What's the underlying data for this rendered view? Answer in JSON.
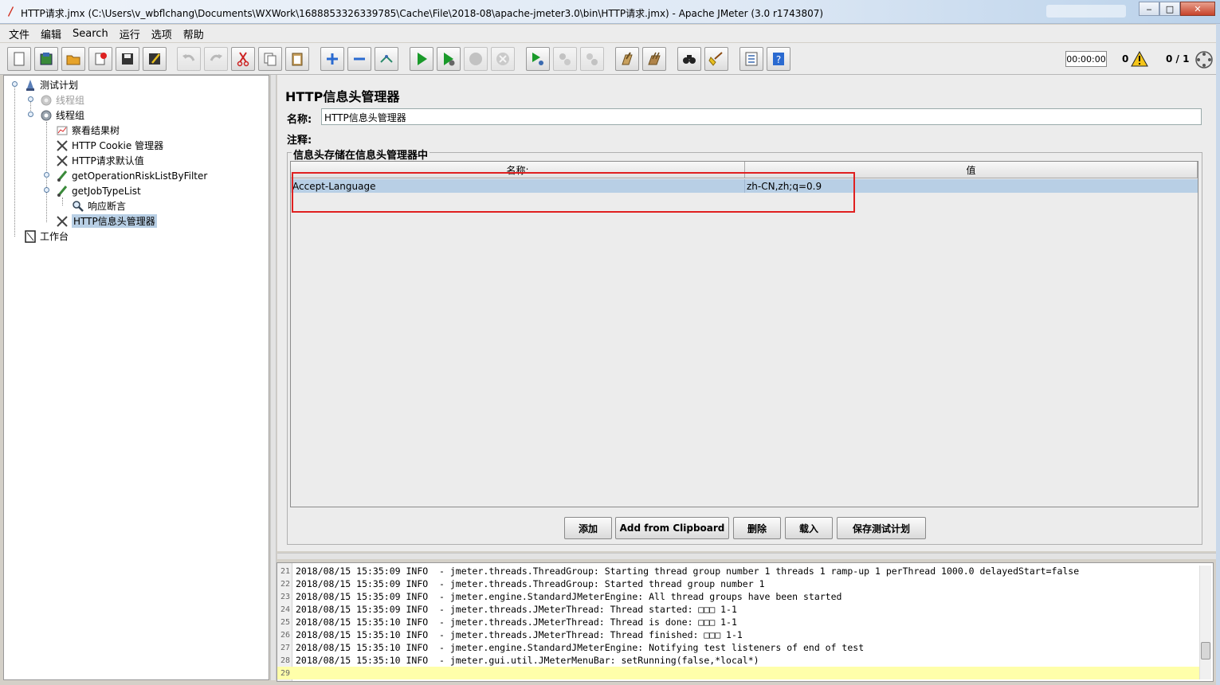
{
  "window": {
    "title": "HTTP请求.jmx (C:\\Users\\v_wbflchang\\Documents\\WXWork\\1688853326339785\\Cache\\File\\2018-08\\apache-jmeter3.0\\bin\\HTTP请求.jmx) - Apache JMeter (3.0 r1743807)",
    "minimize": "‒",
    "maximize": "□",
    "close": "✕"
  },
  "menu": [
    "文件",
    "编辑",
    "Search",
    "运行",
    "选项",
    "帮助"
  ],
  "toolbar": {
    "buttons": [
      {
        "name": "new-icon"
      },
      {
        "name": "templates-icon"
      },
      {
        "name": "open-icon"
      },
      {
        "name": "close-icon"
      },
      {
        "name": "save-icon"
      },
      {
        "name": "save-as-icon"
      },
      {
        "name": "undo-icon",
        "disabled": true
      },
      {
        "name": "redo-icon",
        "disabled": true
      },
      {
        "name": "cut-icon"
      },
      {
        "name": "copy-icon"
      },
      {
        "name": "paste-icon"
      },
      {
        "name": "expand-icon"
      },
      {
        "name": "collapse-icon"
      },
      {
        "name": "toggle-icon"
      },
      {
        "name": "start-icon"
      },
      {
        "name": "start-no-pause-icon"
      },
      {
        "name": "stop-icon",
        "disabled": true
      },
      {
        "name": "shutdown-icon",
        "disabled": true
      },
      {
        "name": "remote-start-icon"
      },
      {
        "name": "remote-stop-icon",
        "disabled": true
      },
      {
        "name": "remote-shutdown-icon",
        "disabled": true
      },
      {
        "name": "clear-icon"
      },
      {
        "name": "clear-all-icon"
      },
      {
        "name": "search-icon"
      },
      {
        "name": "reset-search-icon"
      },
      {
        "name": "function-helper-icon"
      },
      {
        "name": "help-icon"
      }
    ],
    "timer": "00:00:00",
    "error_count": "0",
    "threads": "0 / 1"
  },
  "tree": {
    "items": [
      {
        "label": "测试计划",
        "icon": "test-plan-icon",
        "level": 0
      },
      {
        "label": "线程组",
        "icon": "thread-group-icon",
        "level": 1,
        "disabled": true
      },
      {
        "label": "线程组",
        "icon": "thread-group-icon",
        "level": 1
      },
      {
        "label": "察看结果树",
        "icon": "listener-icon",
        "level": 2
      },
      {
        "label": "HTTP Cookie 管理器",
        "icon": "config-icon",
        "level": 2
      },
      {
        "label": "HTTP请求默认值",
        "icon": "config-icon",
        "level": 2
      },
      {
        "label": "getOperationRiskListByFilter",
        "icon": "sampler-icon",
        "level": 2
      },
      {
        "label": "getJobTypeList",
        "icon": "sampler-icon",
        "level": 2
      },
      {
        "label": "响应断言",
        "icon": "assertion-icon",
        "level": 3
      },
      {
        "label": "HTTP信息头管理器",
        "icon": "config-icon",
        "level": 2,
        "selected": true
      },
      {
        "label": "工作台",
        "icon": "workbench-icon",
        "level": 0
      }
    ]
  },
  "panel": {
    "title": "HTTP信息头管理器",
    "name_label": "名称:",
    "name_value": "HTTP信息头管理器",
    "comment_label": "注释:",
    "comment_value": "",
    "group_title": "信息头存储在信息头管理器中",
    "columns": [
      "名称:",
      "值"
    ],
    "rows": [
      {
        "name": "Accept-Language",
        "value": "zh-CN,zh;q=0.9"
      }
    ],
    "buttons": {
      "add": "添加",
      "add_clipboard": "Add from Clipboard",
      "delete": "删除",
      "load": "载入",
      "save": "保存测试计划"
    }
  },
  "log": {
    "lines": [
      {
        "n": "21",
        "text": "2018/08/15 15:35:09 INFO  - jmeter.threads.ThreadGroup: Starting thread group number 1 threads 1 ramp-up 1 perThread 1000.0 delayedStart=false"
      },
      {
        "n": "22",
        "text": "2018/08/15 15:35:09 INFO  - jmeter.threads.ThreadGroup: Started thread group number 1"
      },
      {
        "n": "23",
        "text": "2018/08/15 15:35:09 INFO  - jmeter.engine.StandardJMeterEngine: All thread groups have been started"
      },
      {
        "n": "24",
        "text": "2018/08/15 15:35:09 INFO  - jmeter.threads.JMeterThread: Thread started: □□□ 1-1"
      },
      {
        "n": "25",
        "text": "2018/08/15 15:35:10 INFO  - jmeter.threads.JMeterThread: Thread is done: □□□ 1-1"
      },
      {
        "n": "26",
        "text": "2018/08/15 15:35:10 INFO  - jmeter.threads.JMeterThread: Thread finished: □□□ 1-1"
      },
      {
        "n": "27",
        "text": "2018/08/15 15:35:10 INFO  - jmeter.engine.StandardJMeterEngine: Notifying test listeners of end of test"
      },
      {
        "n": "28",
        "text": "2018/08/15 15:35:10 INFO  - jmeter.gui.util.JMeterMenuBar: setRunning(false,*local*)"
      },
      {
        "n": "29",
        "text": ""
      }
    ]
  }
}
